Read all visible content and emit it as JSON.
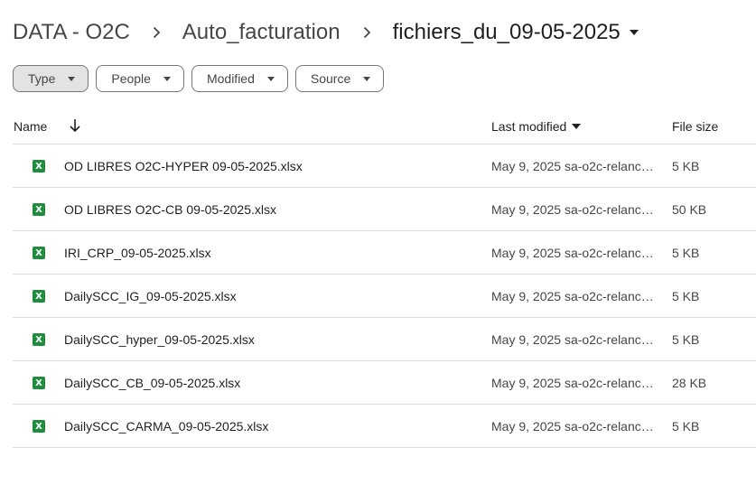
{
  "breadcrumb": {
    "items": [
      "DATA - O2C",
      "Auto_facturation",
      "fichiers_du_09-05-2025"
    ]
  },
  "filters": [
    {
      "label": "Type",
      "selected": true
    },
    {
      "label": "People",
      "selected": false
    },
    {
      "label": "Modified",
      "selected": false
    },
    {
      "label": "Source",
      "selected": false
    }
  ],
  "table": {
    "headers": {
      "name": "Name",
      "last_modified": "Last modified",
      "file_size": "File size"
    },
    "rows": [
      {
        "icon": "excel-icon",
        "icon_letter": "X",
        "name": "OD LIBRES O2C-HYPER 09-05-2025.xlsx",
        "modified": "May 9, 2025 sa-o2c-relance@…",
        "size": "5 KB"
      },
      {
        "icon": "excel-icon",
        "icon_letter": "X",
        "name": "OD LIBRES O2C-CB 09-05-2025.xlsx",
        "modified": "May 9, 2025 sa-o2c-relance@…",
        "size": "50 KB"
      },
      {
        "icon": "excel-icon",
        "icon_letter": "X",
        "name": "IRI_CRP_09-05-2025.xlsx",
        "modified": "May 9, 2025 sa-o2c-relance@…",
        "size": "5 KB"
      },
      {
        "icon": "excel-icon",
        "icon_letter": "X",
        "name": "DailySCC_IG_09-05-2025.xlsx",
        "modified": "May 9, 2025 sa-o2c-relance@…",
        "size": "5 KB"
      },
      {
        "icon": "excel-icon",
        "icon_letter": "X",
        "name": "DailySCC_hyper_09-05-2025.xlsx",
        "modified": "May 9, 2025 sa-o2c-relance@…",
        "size": "5 KB"
      },
      {
        "icon": "excel-icon",
        "icon_letter": "X",
        "name": "DailySCC_CB_09-05-2025.xlsx",
        "modified": "May 9, 2025 sa-o2c-relance@…",
        "size": "28 KB"
      },
      {
        "icon": "excel-icon",
        "icon_letter": "X",
        "name": "DailySCC_CARMA_09-05-2025.xlsx",
        "modified": "May 9, 2025 sa-o2c-relance@…",
        "size": "5 KB"
      }
    ]
  },
  "colors": {
    "excel_green": "#1e8e3e",
    "chip_selected_bg": "#e3e3e3",
    "divider": "#dadce0"
  }
}
